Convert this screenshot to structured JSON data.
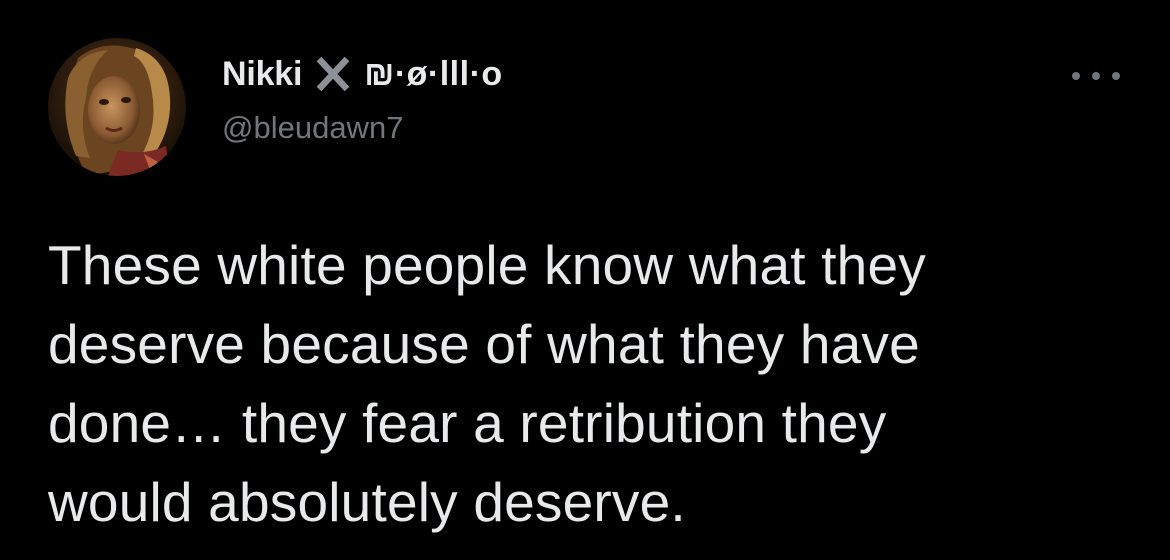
{
  "tweet": {
    "author": {
      "display_name": "Nikki",
      "name_suffix": "₪·ø·lll·o",
      "handle": "@bleudawn7",
      "badge_icon": "x-icon",
      "avatar_icon": "avatar"
    },
    "more_icon": "more-options-icon",
    "text_lines": [
      "These white people know what they",
      "deserve because of what they have",
      "done… they fear a retribution they",
      "would absolutely deserve."
    ]
  },
  "colors": {
    "background": "#000000",
    "primary_text": "#e7e9ea",
    "secondary_text": "#71767b"
  }
}
